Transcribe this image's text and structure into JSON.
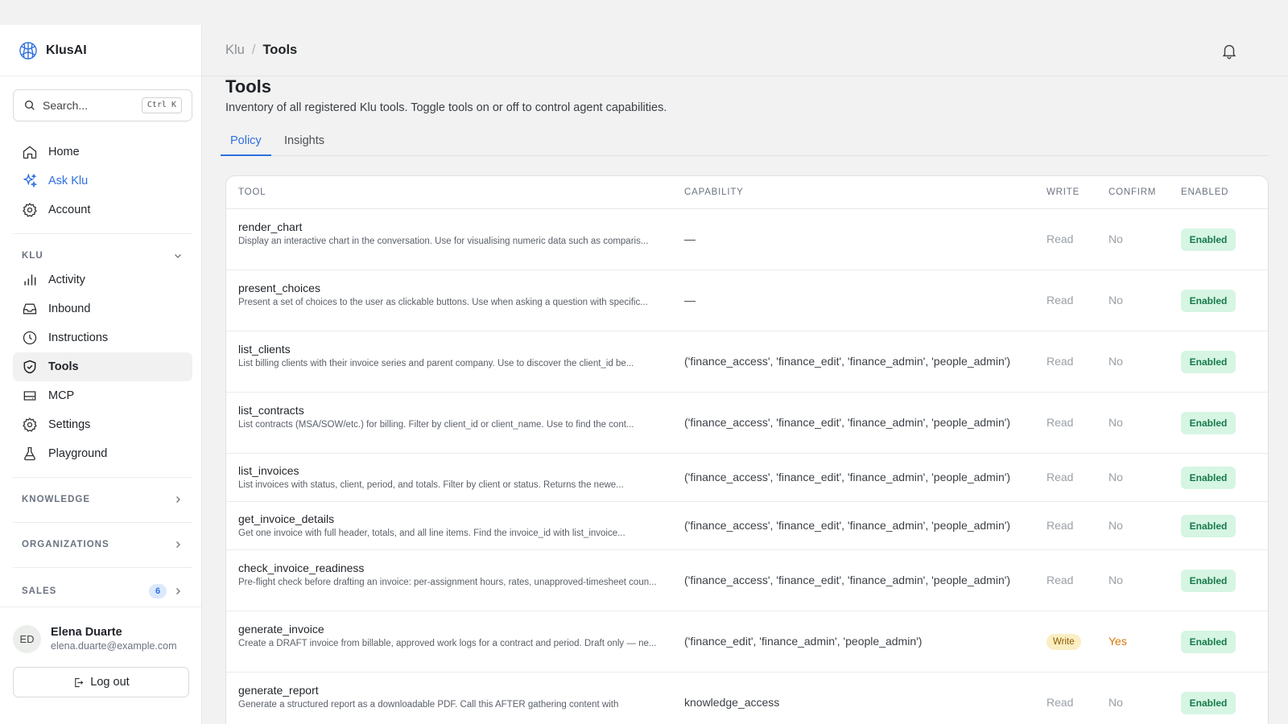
{
  "brand": {
    "name": "KlusAI"
  },
  "search": {
    "placeholder": "Search...",
    "shortcut": "Ctrl K"
  },
  "nav_main": [
    {
      "label": "Home",
      "icon": "home-icon"
    },
    {
      "label": "Ask Klu",
      "icon": "sparkles-icon"
    },
    {
      "label": "Account",
      "icon": "gear-icon"
    }
  ],
  "section_klu": {
    "label": "KLU"
  },
  "nav_klu": [
    {
      "label": "Activity",
      "icon": "bar-chart-icon"
    },
    {
      "label": "Inbound",
      "icon": "inbox-icon"
    },
    {
      "label": "Instructions",
      "icon": "clock-icon"
    },
    {
      "label": "Tools",
      "icon": "shield-check-icon"
    },
    {
      "label": "MCP",
      "icon": "drive-icon"
    },
    {
      "label": "Settings",
      "icon": "gear-icon"
    },
    {
      "label": "Playground",
      "icon": "flask-icon"
    }
  ],
  "sections": {
    "knowledge": "KNOWLEDGE",
    "organizations": "ORGANIZATIONS",
    "sales": "SALES",
    "sales_count": "6"
  },
  "user": {
    "initials": "ED",
    "name": "Elena Duarte",
    "email": "elena.duarte@example.com"
  },
  "logout": {
    "label": "Log out"
  },
  "breadcrumb": {
    "root": "Klu",
    "sep": "/",
    "current": "Tools"
  },
  "page": {
    "title": "Tools",
    "description": "Inventory of all registered Klu tools. Toggle tools on or off to control agent capabilities."
  },
  "tabs": {
    "policy": "Policy",
    "insights": "Insights"
  },
  "table": {
    "headers": {
      "tool": "TOOL",
      "capability": "CAPABILITY",
      "write": "WRITE",
      "confirm": "CONFIRM",
      "enabled": "ENABLED"
    },
    "rows": [
      {
        "name": "render_chart",
        "desc": "Display an interactive chart in the conversation. Use for visualising numeric data such as comparis...",
        "capability": "—",
        "write": "Read",
        "confirm": "No",
        "enabled": "Enabled"
      },
      {
        "name": "present_choices",
        "desc": "Present a set of choices to the user as clickable buttons. Use when asking a question with specific...",
        "capability": "—",
        "write": "Read",
        "confirm": "No",
        "enabled": "Enabled"
      },
      {
        "name": "list_clients",
        "desc": "List billing clients with their invoice series and parent company. Use to discover the client_id be...",
        "capability": "('finance_access', 'finance_edit', 'finance_admin', 'people_admin')",
        "write": "Read",
        "confirm": "No",
        "enabled": "Enabled"
      },
      {
        "name": "list_contracts",
        "desc": "List contracts (MSA/SOW/etc.) for billing. Filter by client_id or client_name. Use to find the cont...",
        "capability": "('finance_access', 'finance_edit', 'finance_admin', 'people_admin')",
        "write": "Read",
        "confirm": "No",
        "enabled": "Enabled"
      },
      {
        "name": "list_invoices",
        "desc": "List invoices with status, client, period, and totals. Filter by client or status. Returns the newe...",
        "capability": "('finance_access', 'finance_edit', 'finance_admin', 'people_admin')",
        "write": "Read",
        "confirm": "No",
        "enabled": "Enabled"
      },
      {
        "name": "get_invoice_details",
        "desc": "Get one invoice with full header, totals, and all line items. Find the invoice_id with list_invoice...",
        "capability": "('finance_access', 'finance_edit', 'finance_admin', 'people_admin')",
        "write": "Read",
        "confirm": "No",
        "enabled": "Enabled"
      },
      {
        "name": "check_invoice_readiness",
        "desc": "Pre-flight check before drafting an invoice: per-assignment hours, rates, unapproved-timesheet coun...",
        "capability": "('finance_access', 'finance_edit', 'finance_admin', 'people_admin')",
        "write": "Read",
        "confirm": "No",
        "enabled": "Enabled"
      },
      {
        "name": "generate_invoice",
        "desc": "Create a DRAFT invoice from billable, approved work logs for a contract and period. Draft only — ne...",
        "capability": "('finance_edit', 'finance_admin', 'people_admin')",
        "write": "Write",
        "confirm": "Yes",
        "enabled": "Enabled"
      },
      {
        "name": "generate_report",
        "desc": "Generate a structured report as a downloadable PDF. Call this AFTER gathering content with",
        "capability": "knowledge_access",
        "write": "Read",
        "confirm": "No",
        "enabled": "Enabled"
      }
    ]
  },
  "colors": {
    "accent": "#2f6fdf",
    "enabled_bg": "#d6f5e3",
    "enabled_text": "#16794a",
    "write_badge_bg": "#fbeec2",
    "confirm_yes": "#d97706"
  }
}
